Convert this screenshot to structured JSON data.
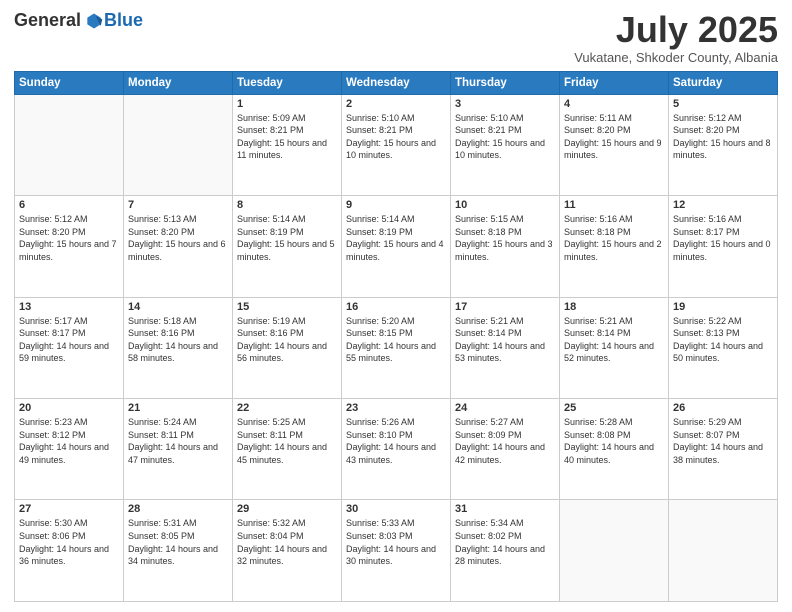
{
  "logo": {
    "general": "General",
    "blue": "Blue"
  },
  "header": {
    "month": "July 2025",
    "location": "Vukatane, Shkoder County, Albania"
  },
  "weekdays": [
    "Sunday",
    "Monday",
    "Tuesday",
    "Wednesday",
    "Thursday",
    "Friday",
    "Saturday"
  ],
  "weeks": [
    [
      {
        "day": "",
        "sunrise": "",
        "sunset": "",
        "daylight": ""
      },
      {
        "day": "",
        "sunrise": "",
        "sunset": "",
        "daylight": ""
      },
      {
        "day": "1",
        "sunrise": "Sunrise: 5:09 AM",
        "sunset": "Sunset: 8:21 PM",
        "daylight": "Daylight: 15 hours and 11 minutes."
      },
      {
        "day": "2",
        "sunrise": "Sunrise: 5:10 AM",
        "sunset": "Sunset: 8:21 PM",
        "daylight": "Daylight: 15 hours and 10 minutes."
      },
      {
        "day": "3",
        "sunrise": "Sunrise: 5:10 AM",
        "sunset": "Sunset: 8:21 PM",
        "daylight": "Daylight: 15 hours and 10 minutes."
      },
      {
        "day": "4",
        "sunrise": "Sunrise: 5:11 AM",
        "sunset": "Sunset: 8:20 PM",
        "daylight": "Daylight: 15 hours and 9 minutes."
      },
      {
        "day": "5",
        "sunrise": "Sunrise: 5:12 AM",
        "sunset": "Sunset: 8:20 PM",
        "daylight": "Daylight: 15 hours and 8 minutes."
      }
    ],
    [
      {
        "day": "6",
        "sunrise": "Sunrise: 5:12 AM",
        "sunset": "Sunset: 8:20 PM",
        "daylight": "Daylight: 15 hours and 7 minutes."
      },
      {
        "day": "7",
        "sunrise": "Sunrise: 5:13 AM",
        "sunset": "Sunset: 8:20 PM",
        "daylight": "Daylight: 15 hours and 6 minutes."
      },
      {
        "day": "8",
        "sunrise": "Sunrise: 5:14 AM",
        "sunset": "Sunset: 8:19 PM",
        "daylight": "Daylight: 15 hours and 5 minutes."
      },
      {
        "day": "9",
        "sunrise": "Sunrise: 5:14 AM",
        "sunset": "Sunset: 8:19 PM",
        "daylight": "Daylight: 15 hours and 4 minutes."
      },
      {
        "day": "10",
        "sunrise": "Sunrise: 5:15 AM",
        "sunset": "Sunset: 8:18 PM",
        "daylight": "Daylight: 15 hours and 3 minutes."
      },
      {
        "day": "11",
        "sunrise": "Sunrise: 5:16 AM",
        "sunset": "Sunset: 8:18 PM",
        "daylight": "Daylight: 15 hours and 2 minutes."
      },
      {
        "day": "12",
        "sunrise": "Sunrise: 5:16 AM",
        "sunset": "Sunset: 8:17 PM",
        "daylight": "Daylight: 15 hours and 0 minutes."
      }
    ],
    [
      {
        "day": "13",
        "sunrise": "Sunrise: 5:17 AM",
        "sunset": "Sunset: 8:17 PM",
        "daylight": "Daylight: 14 hours and 59 minutes."
      },
      {
        "day": "14",
        "sunrise": "Sunrise: 5:18 AM",
        "sunset": "Sunset: 8:16 PM",
        "daylight": "Daylight: 14 hours and 58 minutes."
      },
      {
        "day": "15",
        "sunrise": "Sunrise: 5:19 AM",
        "sunset": "Sunset: 8:16 PM",
        "daylight": "Daylight: 14 hours and 56 minutes."
      },
      {
        "day": "16",
        "sunrise": "Sunrise: 5:20 AM",
        "sunset": "Sunset: 8:15 PM",
        "daylight": "Daylight: 14 hours and 55 minutes."
      },
      {
        "day": "17",
        "sunrise": "Sunrise: 5:21 AM",
        "sunset": "Sunset: 8:14 PM",
        "daylight": "Daylight: 14 hours and 53 minutes."
      },
      {
        "day": "18",
        "sunrise": "Sunrise: 5:21 AM",
        "sunset": "Sunset: 8:14 PM",
        "daylight": "Daylight: 14 hours and 52 minutes."
      },
      {
        "day": "19",
        "sunrise": "Sunrise: 5:22 AM",
        "sunset": "Sunset: 8:13 PM",
        "daylight": "Daylight: 14 hours and 50 minutes."
      }
    ],
    [
      {
        "day": "20",
        "sunrise": "Sunrise: 5:23 AM",
        "sunset": "Sunset: 8:12 PM",
        "daylight": "Daylight: 14 hours and 49 minutes."
      },
      {
        "day": "21",
        "sunrise": "Sunrise: 5:24 AM",
        "sunset": "Sunset: 8:11 PM",
        "daylight": "Daylight: 14 hours and 47 minutes."
      },
      {
        "day": "22",
        "sunrise": "Sunrise: 5:25 AM",
        "sunset": "Sunset: 8:11 PM",
        "daylight": "Daylight: 14 hours and 45 minutes."
      },
      {
        "day": "23",
        "sunrise": "Sunrise: 5:26 AM",
        "sunset": "Sunset: 8:10 PM",
        "daylight": "Daylight: 14 hours and 43 minutes."
      },
      {
        "day": "24",
        "sunrise": "Sunrise: 5:27 AM",
        "sunset": "Sunset: 8:09 PM",
        "daylight": "Daylight: 14 hours and 42 minutes."
      },
      {
        "day": "25",
        "sunrise": "Sunrise: 5:28 AM",
        "sunset": "Sunset: 8:08 PM",
        "daylight": "Daylight: 14 hours and 40 minutes."
      },
      {
        "day": "26",
        "sunrise": "Sunrise: 5:29 AM",
        "sunset": "Sunset: 8:07 PM",
        "daylight": "Daylight: 14 hours and 38 minutes."
      }
    ],
    [
      {
        "day": "27",
        "sunrise": "Sunrise: 5:30 AM",
        "sunset": "Sunset: 8:06 PM",
        "daylight": "Daylight: 14 hours and 36 minutes."
      },
      {
        "day": "28",
        "sunrise": "Sunrise: 5:31 AM",
        "sunset": "Sunset: 8:05 PM",
        "daylight": "Daylight: 14 hours and 34 minutes."
      },
      {
        "day": "29",
        "sunrise": "Sunrise: 5:32 AM",
        "sunset": "Sunset: 8:04 PM",
        "daylight": "Daylight: 14 hours and 32 minutes."
      },
      {
        "day": "30",
        "sunrise": "Sunrise: 5:33 AM",
        "sunset": "Sunset: 8:03 PM",
        "daylight": "Daylight: 14 hours and 30 minutes."
      },
      {
        "day": "31",
        "sunrise": "Sunrise: 5:34 AM",
        "sunset": "Sunset: 8:02 PM",
        "daylight": "Daylight: 14 hours and 28 minutes."
      },
      {
        "day": "",
        "sunrise": "",
        "sunset": "",
        "daylight": ""
      },
      {
        "day": "",
        "sunrise": "",
        "sunset": "",
        "daylight": ""
      }
    ]
  ]
}
